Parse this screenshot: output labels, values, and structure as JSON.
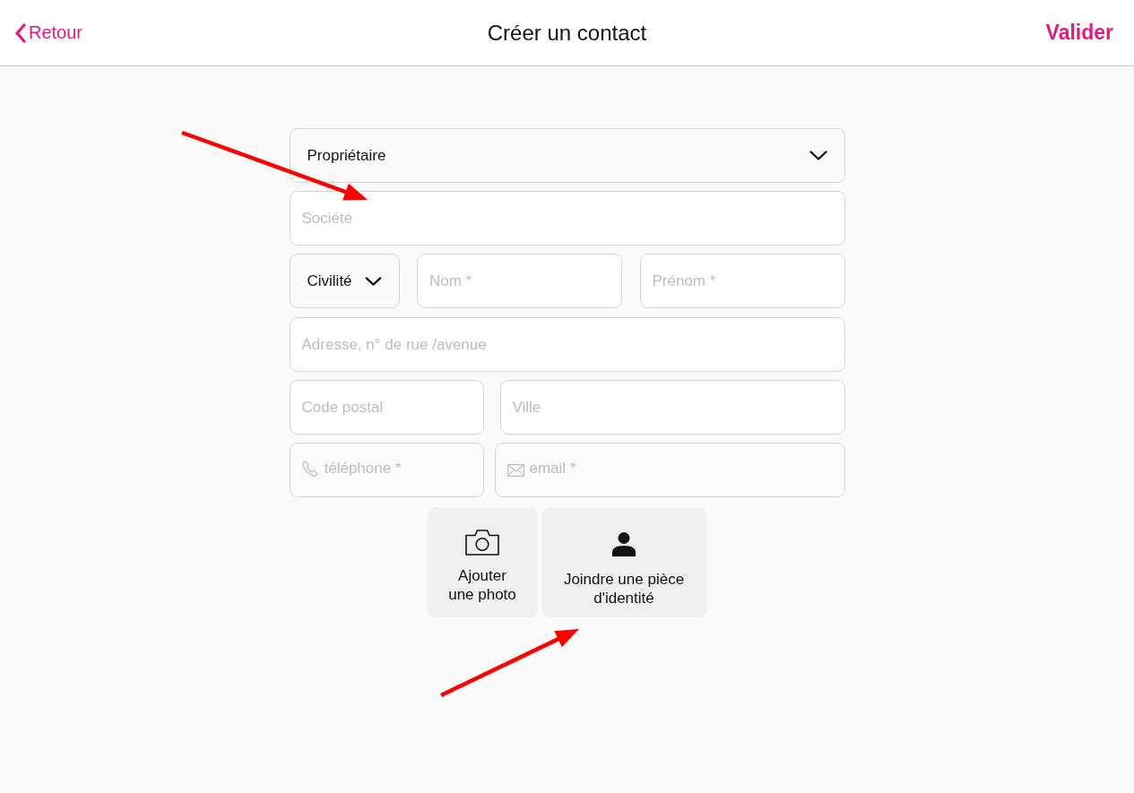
{
  "header": {
    "back": {
      "label": "Retour"
    },
    "title": "Créer un contact",
    "action": {
      "label": "Valider"
    }
  },
  "form": {
    "rows": [
      [
        {
          "kind": "select",
          "value": "Propriétaire"
        }
      ],
      [
        {
          "kind": "text",
          "placeholder": "Société"
        }
      ],
      [
        {
          "kind": "select",
          "value": "Civilité"
        },
        {
          "kind": "text",
          "placeholder": "Nom *"
        },
        {
          "kind": "text",
          "placeholder": "Prénom *"
        }
      ],
      [
        {
          "kind": "text",
          "placeholder": "Adresse, n° de rue /avenue"
        }
      ],
      [
        {
          "kind": "text",
          "placeholder": "Code postal"
        },
        {
          "kind": "text",
          "placeholder": "Ville"
        }
      ],
      [
        {
          "kind": "phone",
          "placeholder": "téléphone *"
        },
        {
          "kind": "email",
          "placeholder": "email *"
        }
      ]
    ]
  },
  "attachments": [
    {
      "kind": "photo",
      "label_lines": [
        "Ajouter",
        "une photo"
      ]
    },
    {
      "kind": "identity",
      "label_lines": [
        "Joindre une pièce",
        "d'identité"
      ]
    }
  ]
}
